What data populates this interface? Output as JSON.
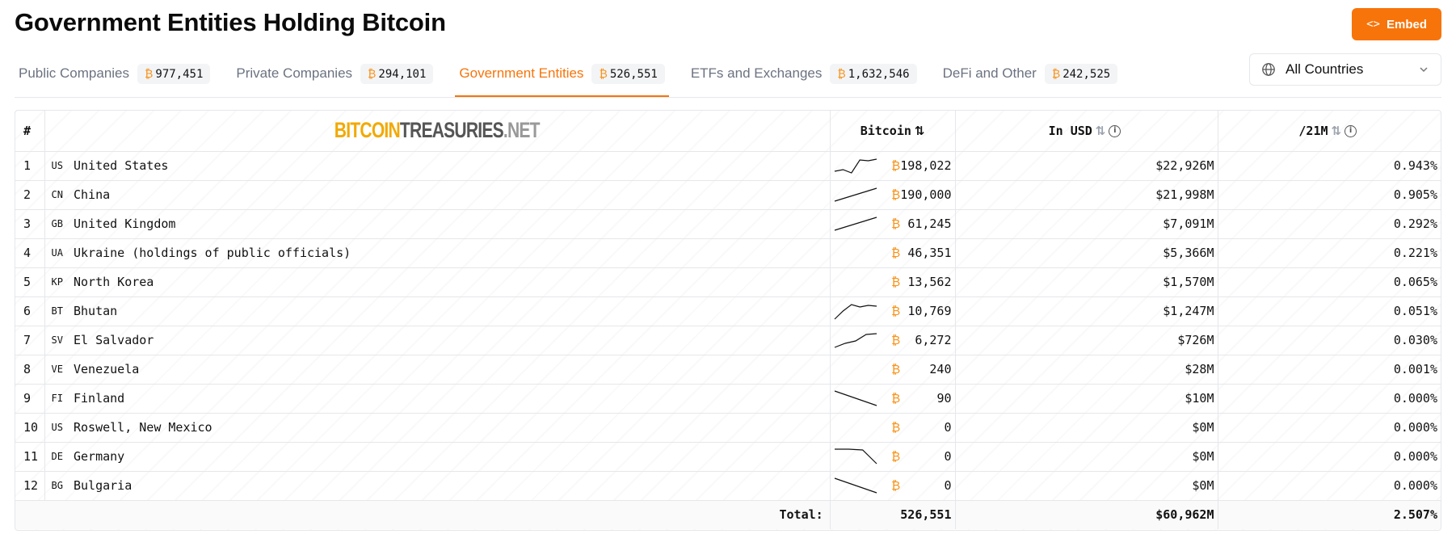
{
  "header": {
    "title": "Government Entities Holding Bitcoin",
    "embed_label": "Embed"
  },
  "tabs": [
    {
      "label": "Public Companies",
      "count": "977,451",
      "active": false
    },
    {
      "label": "Private Companies",
      "count": "294,101",
      "active": false
    },
    {
      "label": "Government Entities",
      "count": "526,551",
      "active": true
    },
    {
      "label": "ETFs and Exchanges",
      "count": "1,632,546",
      "active": false
    },
    {
      "label": "DeFi and Other",
      "count": "242,525",
      "active": false
    }
  ],
  "btc_symbol": "₿",
  "country_filter": {
    "value": "All Countries"
  },
  "table": {
    "headers": {
      "rank": "#",
      "logo": {
        "part1": "BITCOIN",
        "part2": "TREASURIES",
        "part3": ".NET"
      },
      "bitcoin": "Bitcoin",
      "usd": "In USD",
      "pct": "/21M"
    },
    "rows": [
      {
        "rank": "1",
        "code": "US",
        "name": "United States",
        "btc": "198,022",
        "usd": "$22,926M",
        "pct": "0.943%",
        "spark": [
          0.15,
          0.25,
          0.05,
          0.85,
          0.8,
          0.9
        ]
      },
      {
        "rank": "2",
        "code": "CN",
        "name": "China",
        "btc": "190,000",
        "usd": "$21,998M",
        "pct": "0.905%",
        "spark": [
          0.1,
          0.5,
          0.9
        ]
      },
      {
        "rank": "3",
        "code": "GB",
        "name": "United Kingdom",
        "btc": "61,245",
        "usd": "$7,091M",
        "pct": "0.292%",
        "spark": [
          0.1,
          0.5,
          0.9
        ]
      },
      {
        "rank": "4",
        "code": "UA",
        "name": "Ukraine (holdings of public officials)",
        "btc": "46,351",
        "usd": "$5,366M",
        "pct": "0.221%",
        "spark": []
      },
      {
        "rank": "5",
        "code": "KP",
        "name": "North Korea",
        "btc": "13,562",
        "usd": "$1,570M",
        "pct": "0.065%",
        "spark": []
      },
      {
        "rank": "6",
        "code": "BT",
        "name": "Bhutan",
        "btc": "10,769",
        "usd": "$1,247M",
        "pct": "0.051%",
        "spark": [
          0.0,
          0.5,
          0.9,
          0.75,
          0.85,
          0.8
        ]
      },
      {
        "rank": "7",
        "code": "SV",
        "name": "El Salvador",
        "btc": "6,272",
        "usd": "$726M",
        "pct": "0.030%",
        "spark": [
          0.05,
          0.3,
          0.45,
          0.85,
          0.9
        ]
      },
      {
        "rank": "8",
        "code": "VE",
        "name": "Venezuela",
        "btc": "240",
        "usd": "$28M",
        "pct": "0.001%",
        "spark": []
      },
      {
        "rank": "9",
        "code": "FI",
        "name": "Finland",
        "btc": "90",
        "usd": "$10M",
        "pct": "0.000%",
        "spark": [
          0.95,
          0.5,
          0.05
        ]
      },
      {
        "rank": "10",
        "code": "US",
        "name": "Roswell, New Mexico",
        "btc": "0",
        "usd": "$0M",
        "pct": "0.000%",
        "spark": []
      },
      {
        "rank": "11",
        "code": "DE",
        "name": "Germany",
        "btc": "0",
        "usd": "$0M",
        "pct": "0.000%",
        "spark": [
          0.95,
          0.95,
          0.9,
          0.05
        ]
      },
      {
        "rank": "12",
        "code": "BG",
        "name": "Bulgaria",
        "btc": "0",
        "usd": "$0M",
        "pct": "0.000%",
        "spark": [
          0.95,
          0.5,
          0.05
        ]
      }
    ],
    "total": {
      "label": "Total:",
      "btc": "526,551",
      "usd": "$60,962M",
      "pct": "2.507%"
    }
  },
  "colors": {
    "accent": "#f7740a",
    "btc": "#f7931a"
  },
  "icons": {
    "embed": "code-icon",
    "filter": "globe-icon",
    "dropdown": "chevron-down-icon",
    "sort": "sort-arrows-icon",
    "info": "info-icon"
  }
}
